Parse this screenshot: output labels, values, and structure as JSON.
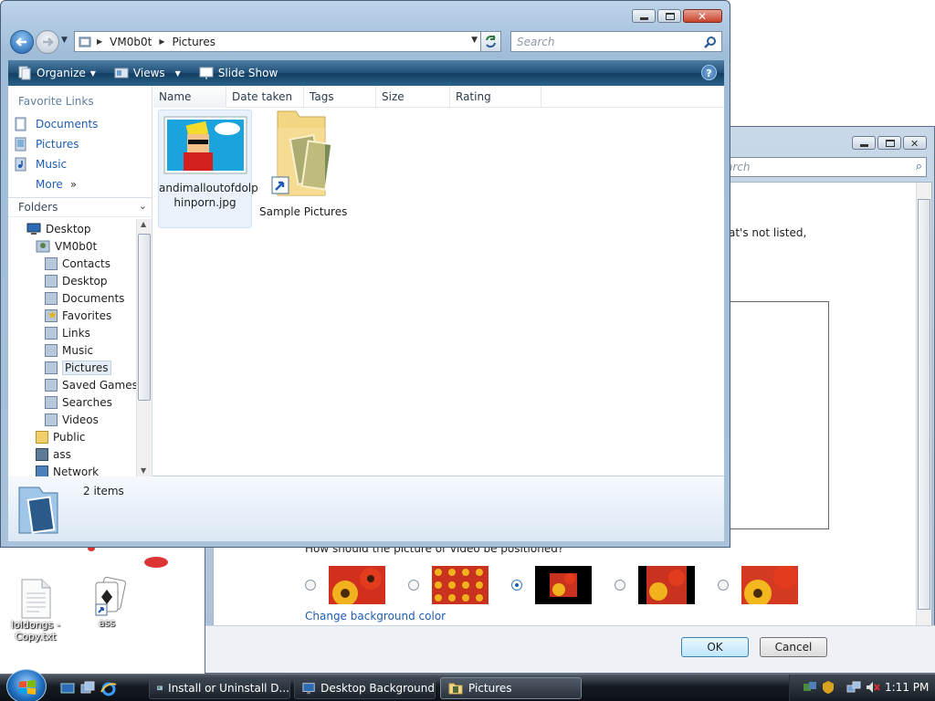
{
  "desktop": {
    "icons": [
      {
        "label": "loldongs - Copy.txt"
      },
      {
        "label": "ass"
      }
    ]
  },
  "bg_dialog": {
    "search_placeholder": "Search",
    "partial_text": "at's not listed,",
    "position_question": "How should the picture or video be positioned?",
    "change_bg_color": "Change background color",
    "ok": "OK",
    "cancel": "Cancel"
  },
  "explorer": {
    "breadcrumb": [
      "VM0b0t",
      "Pictures"
    ],
    "search_placeholder": "Search",
    "commands": {
      "organize": "Organize",
      "views": "Views",
      "slideshow": "Slide Show",
      "help": "?"
    },
    "favorite_links_title": "Favorite Links",
    "favorites": [
      "Documents",
      "Pictures",
      "Music"
    ],
    "more": "More",
    "folders_title": "Folders",
    "tree": [
      {
        "label": "Desktop",
        "level": 0,
        "icon": "desktop-icon"
      },
      {
        "label": "VM0b0t",
        "level": 1,
        "icon": "user-folder-icon"
      },
      {
        "label": "Contacts",
        "level": 2,
        "icon": "contacts-folder-icon"
      },
      {
        "label": "Desktop",
        "level": 2,
        "icon": "desktop-folder-icon"
      },
      {
        "label": "Documents",
        "level": 2,
        "icon": "documents-folder-icon"
      },
      {
        "label": "Favorites",
        "level": 2,
        "icon": "favorites-folder-icon"
      },
      {
        "label": "Links",
        "level": 2,
        "icon": "links-folder-icon"
      },
      {
        "label": "Music",
        "level": 2,
        "icon": "music-folder-icon"
      },
      {
        "label": "Pictures",
        "level": 2,
        "icon": "pictures-folder-icon",
        "selected": true
      },
      {
        "label": "Saved Games",
        "level": 2,
        "icon": "saved-games-folder-icon"
      },
      {
        "label": "Searches",
        "level": 2,
        "icon": "searches-folder-icon"
      },
      {
        "label": "Videos",
        "level": 2,
        "icon": "videos-folder-icon"
      },
      {
        "label": "Public",
        "level": 1,
        "icon": "public-folder-icon"
      },
      {
        "label": "ass",
        "level": 1,
        "icon": "computer-icon"
      },
      {
        "label": "Network",
        "level": 1,
        "icon": "network-icon"
      }
    ],
    "columns": [
      "Name",
      "Date taken",
      "Tags",
      "Size",
      "Rating"
    ],
    "files": [
      {
        "name": "andimalloutofdolphinporn.jpg",
        "name_line1": "andimalloutofdolp",
        "name_line2": "hinporn.jpg"
      },
      {
        "name": "Sample Pictures"
      }
    ],
    "status_count": "2 items"
  },
  "taskbar": {
    "tasks": [
      "Install or Uninstall D...",
      "Desktop Background",
      "Pictures"
    ],
    "clock": "1:11 PM"
  }
}
